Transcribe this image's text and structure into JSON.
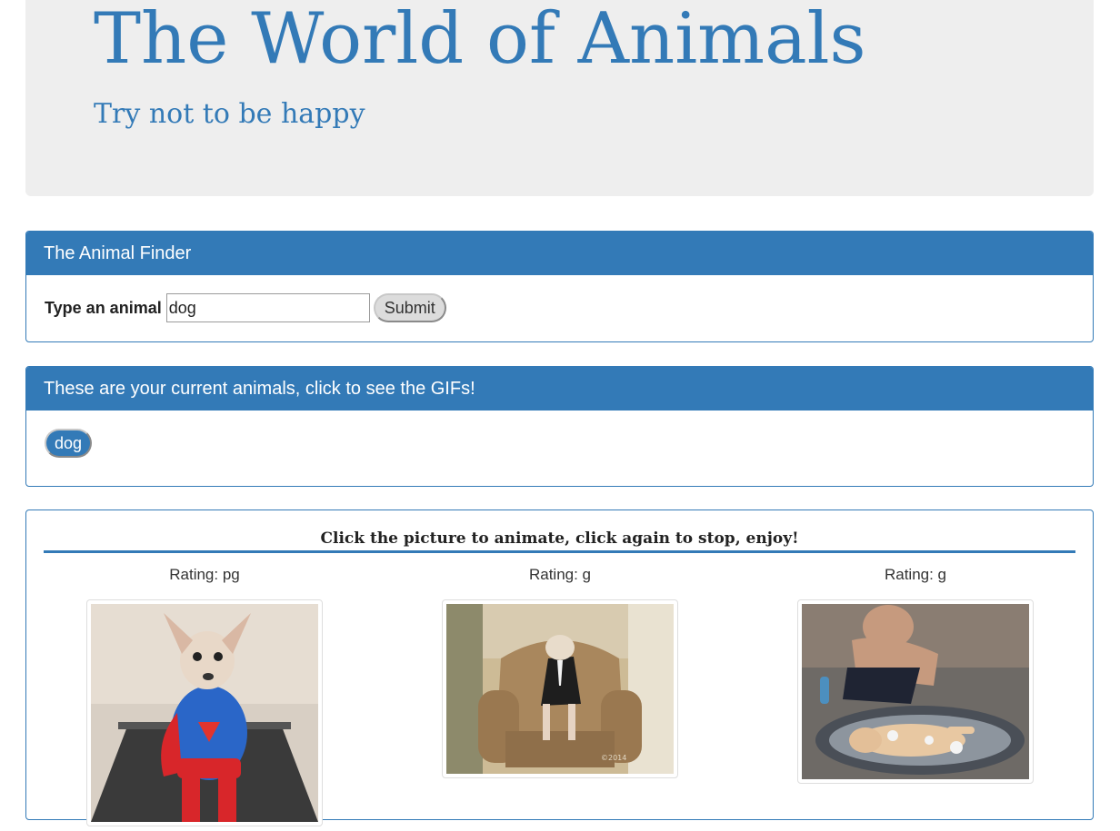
{
  "header": {
    "title": "The World of Animals",
    "subtitle": "Try not to be happy"
  },
  "finder": {
    "heading": "The Animal Finder",
    "label": "Type an animal",
    "input_value": "dog",
    "submit_label": "Submit"
  },
  "current": {
    "heading": "These are your current animals, click to see the GIFs!",
    "animals": [
      "dog"
    ]
  },
  "gifs": {
    "title": "Click the picture to animate, click again to stop, enjoy!",
    "items": [
      {
        "rating": "Rating: pg",
        "image": "chihuahua-superman-costume-gif"
      },
      {
        "rating": "Rating: g",
        "image": "dog-dressed-on-armchair-gif"
      },
      {
        "rating": "Rating: g",
        "image": "dog-bath-in-tub-gif"
      }
    ]
  },
  "colors": {
    "primary": "#337ab7",
    "jumbotron_bg": "#eeeeee"
  }
}
